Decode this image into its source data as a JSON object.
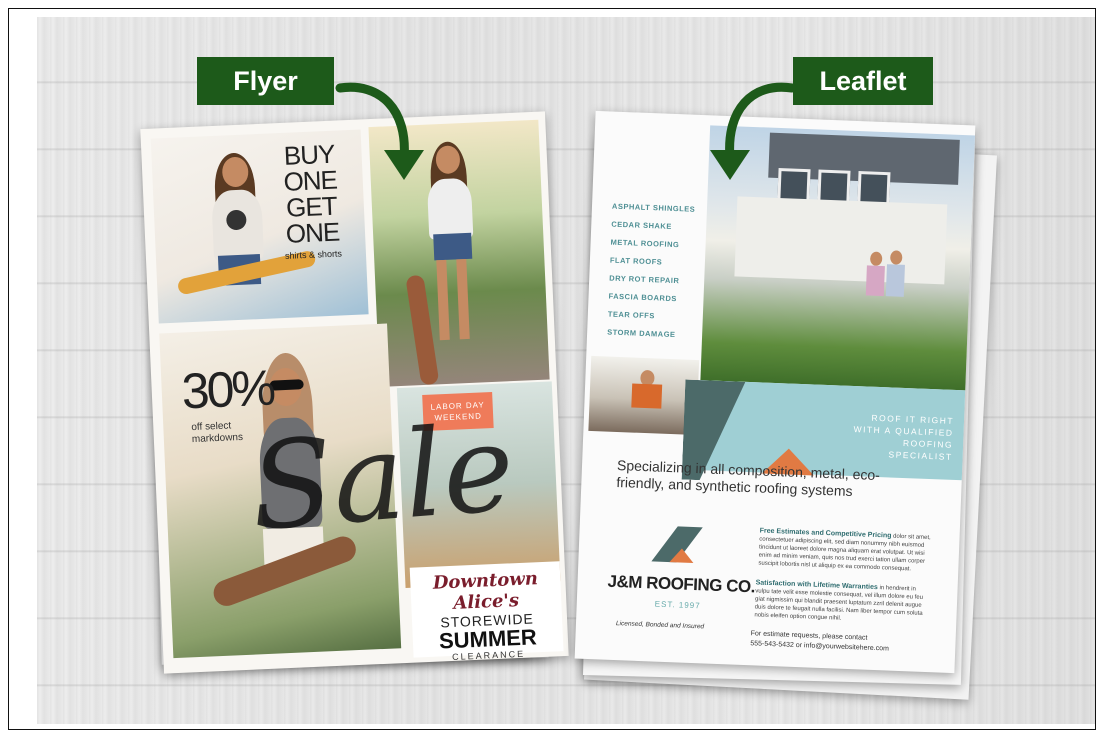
{
  "labels": {
    "flyer": "Flyer",
    "leaflet": "Leaflet"
  },
  "colors": {
    "tag_bg": "#1d5a1a",
    "arrow": "#1d5a1a"
  },
  "flyer": {
    "bogo_line1": "BUY ONE",
    "bogo_line2": "GET ONE",
    "bogo_line3": "shirts & shorts",
    "percent": "30%",
    "percent_sub1": "off select",
    "percent_sub2": "markdowns",
    "labor_day": "LABOR DAY",
    "weekend": "WEEKEND",
    "sale": "Sale",
    "downtown": "Downtown Alice's",
    "storewide": "STOREWIDE",
    "summer": "SUMMER",
    "clearance": "CLEARANCE"
  },
  "leaflet": {
    "services": [
      "ASPHALT SHINGLES",
      "CEDAR SHAKE",
      "METAL ROOFING",
      "FLAT ROOFS",
      "DRY ROT REPAIR",
      "FASCIA BOARDS",
      "TEAR OFFS",
      "STORM DAMAGE"
    ],
    "roof_it_right_1": "ROOF IT RIGHT",
    "roof_it_right_2": "WITH A QUALIFIED",
    "roof_it_right_3": "ROOFING SPECIALIST",
    "specializing": "Specializing in all composition, metal, eco-friendly, and synthetic roofing systems",
    "company": "J&M ROOFING CO.",
    "est": "EST. 1997",
    "licensed": "Licensed, Bonded and Insured",
    "free_title": "Free Estimates and Competitive Pricing",
    "free_body": "dolor sit amet, consectetuer adipiscing elit, sed diam nonummy nibh euismod tincidunt ut laoreet dolore magna aliquam erat volutpat. Ut wisi enim ad minim veniam, quis nos trud exerci tation ullam corper suscipit lobortis nisl ut aliquip ex ea commodo consequat.",
    "sat_title": "Satisfaction with Lifetime Warranties",
    "sat_body": "in hendrerit in vulpu tate velit esse molestie consequat, vel illum dolore eu feu giat nigmissim qui blandit praesent luptatum zzril delenit augue duis dolore te feugait nulla facilisi. Nam liber tempor cum soluta nobis eleifen option congue nihil.",
    "contact_1": "For estimate requests, please contact",
    "contact_2": "555-543-5432 or info@yourwebsitehere.com"
  }
}
